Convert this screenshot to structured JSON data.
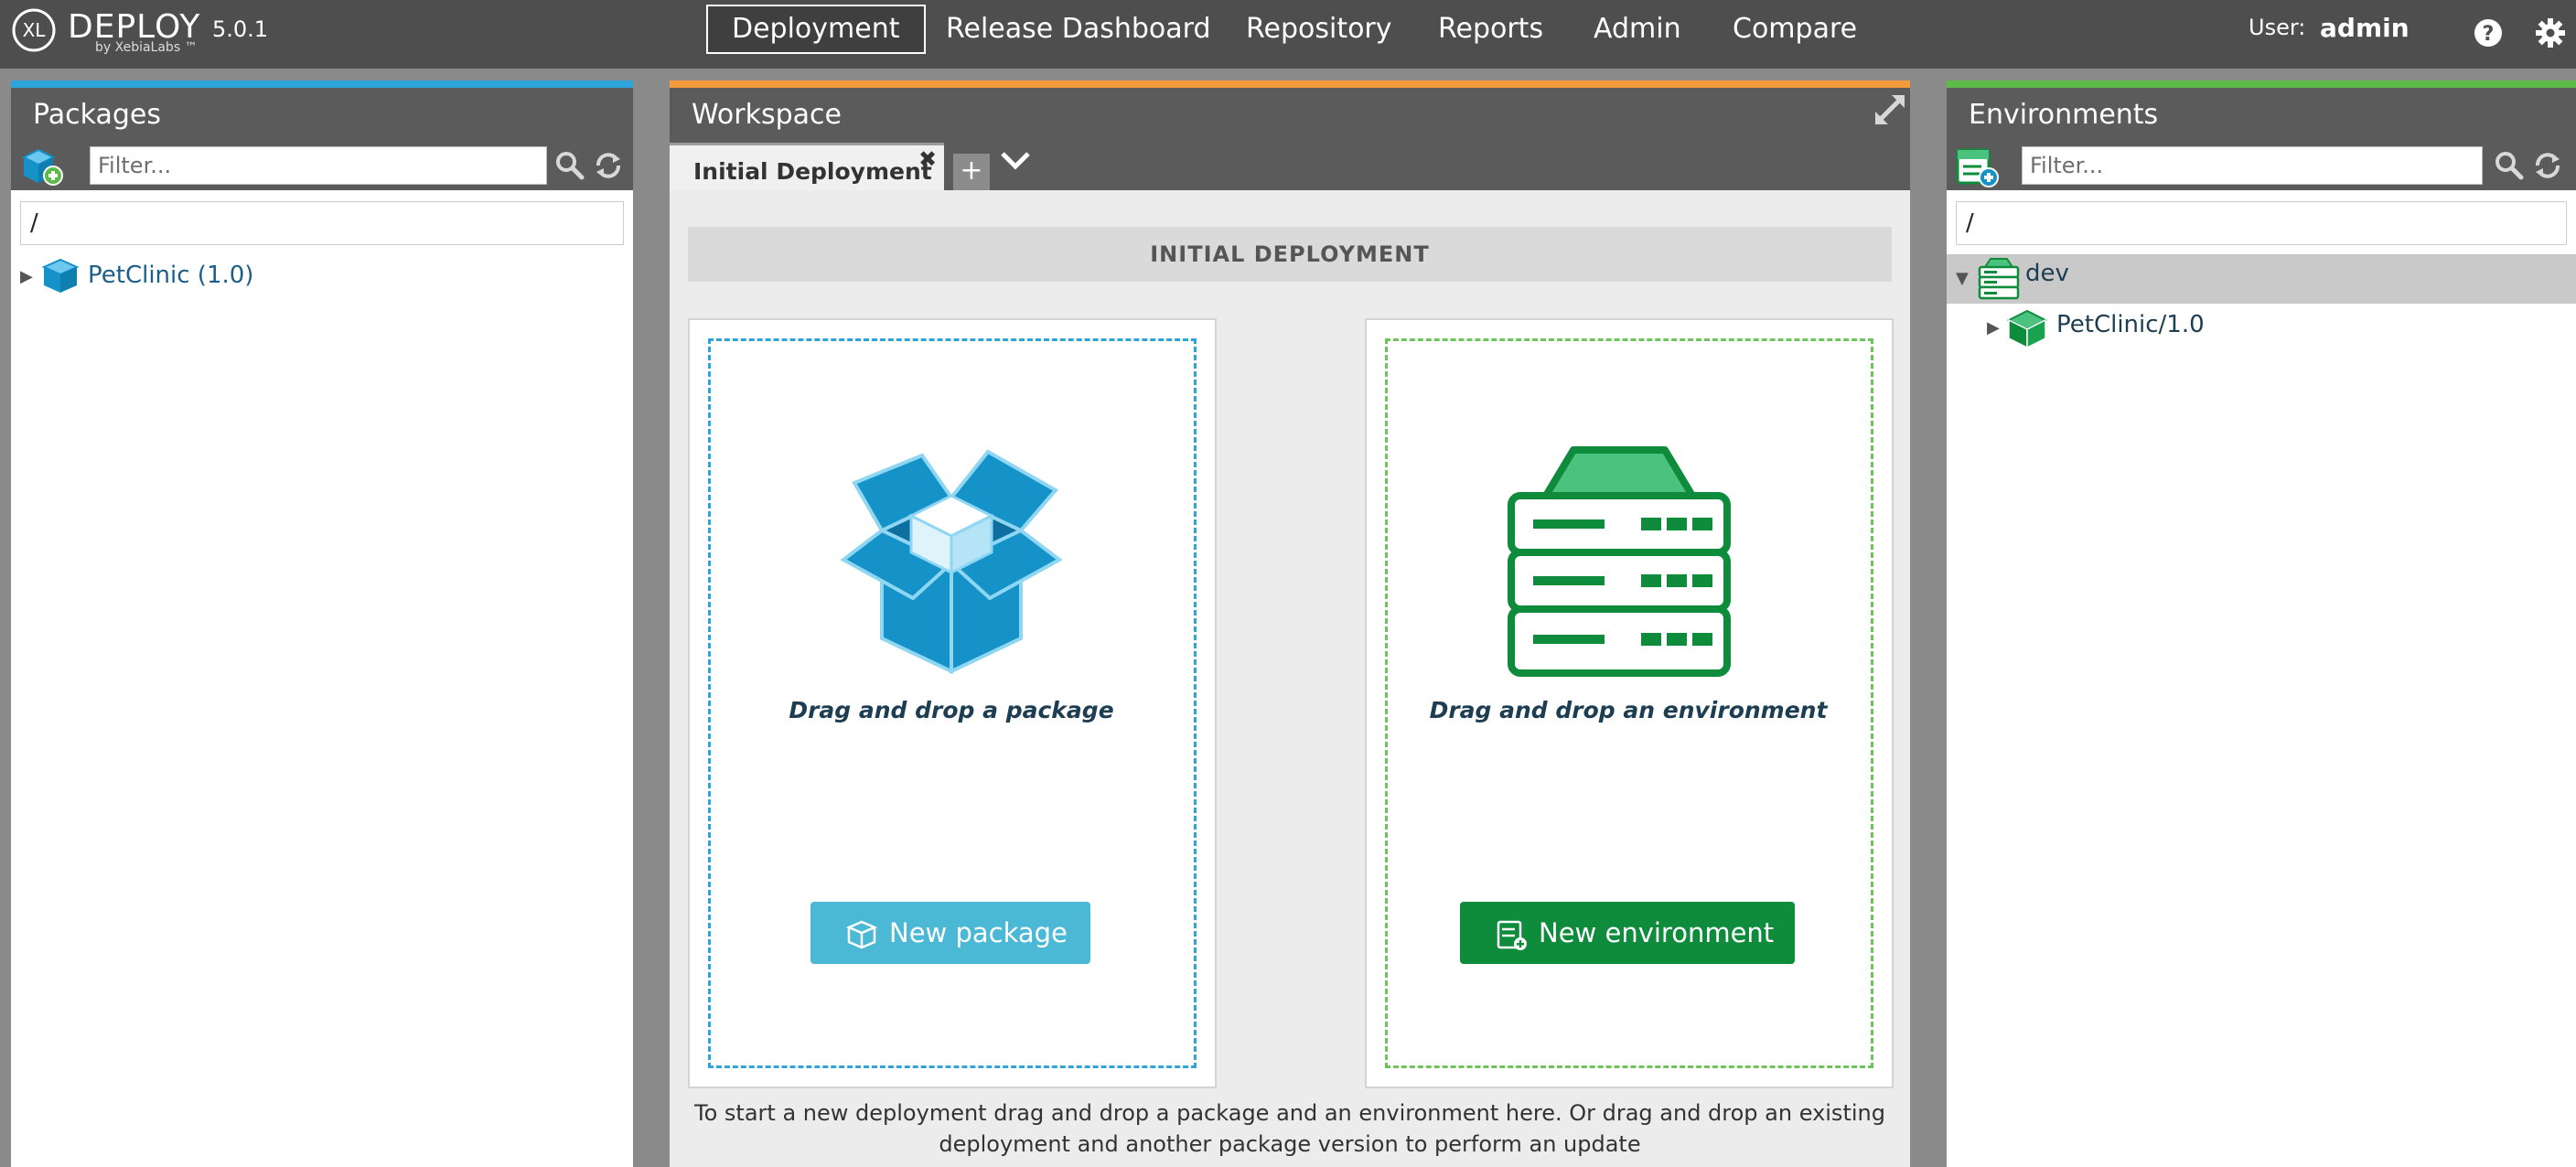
{
  "app": {
    "logo_text": "DEPLOY",
    "logo_sub": "by XebiaLabs ™",
    "version": "5.0.1"
  },
  "nav": {
    "items": [
      "Deployment",
      "Release Dashboard",
      "Repository",
      "Reports",
      "Admin",
      "Compare"
    ],
    "active": "Deployment"
  },
  "user": {
    "label": "User:",
    "name": "admin"
  },
  "packages": {
    "title": "Packages",
    "filter_placeholder": "Filter...",
    "path": "/",
    "tree": [
      {
        "label": "PetClinic (1.0)",
        "expanded": false
      }
    ]
  },
  "workspace": {
    "title": "Workspace",
    "tab_label": "Initial Deployment",
    "tab_close": "✖",
    "tab_add": "+",
    "header": "INITIAL DEPLOYMENT",
    "package_drop_text": "Drag and drop a package",
    "environment_drop_text": "Drag and drop an environment",
    "new_package_label": "New package",
    "new_environment_label": "New environment",
    "help_line1": "To start a new deployment drag and drop a package and an environment here. Or drag and drop an existing",
    "help_line2": "deployment and another package version to perform an update"
  },
  "environments": {
    "title": "Environments",
    "filter_placeholder": "Filter...",
    "path": "/",
    "tree": [
      {
        "label": "dev",
        "expanded": true,
        "selected": true
      },
      {
        "label": "PetClinic/1.0",
        "expanded": false
      }
    ]
  },
  "colors": {
    "topbar": "#4e4e4e",
    "packages_accent": "#2fa4d8",
    "workspace_accent": "#f39a3c",
    "environments_accent": "#5cba47",
    "package_blue": "#1592c8",
    "env_green": "#0f8b3c",
    "new_package_button": "#4bb9d6",
    "new_environment_button": "#0f8b3c"
  },
  "icons": {
    "logo": "xl-logo-icon",
    "help": "question-icon",
    "settings": "gear-icon",
    "search": "search-icon",
    "refresh": "refresh-icon",
    "expand": "expand-icon",
    "package": "package-box-icon",
    "environment": "server-stack-icon"
  }
}
